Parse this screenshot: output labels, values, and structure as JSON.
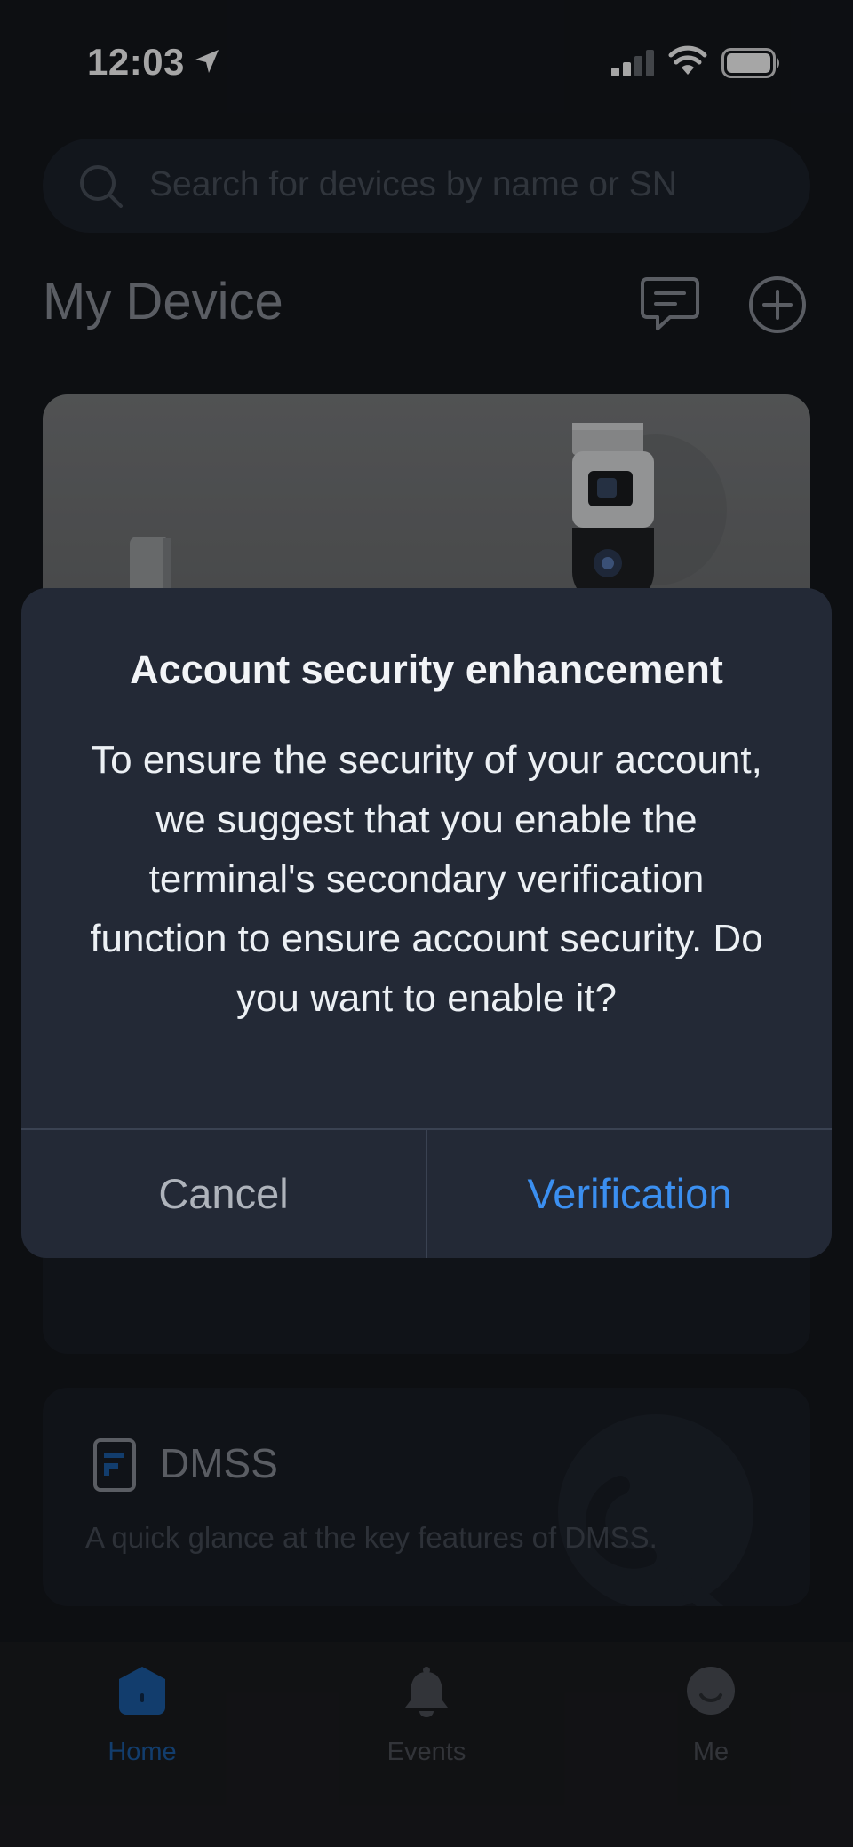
{
  "status_bar": {
    "time": "12:03"
  },
  "search": {
    "placeholder": "Search for devices by name or SN"
  },
  "header": {
    "title": "My Device"
  },
  "dmss_card": {
    "title": "DMSS",
    "description": "A quick glance at the key features of DMSS."
  },
  "dialog": {
    "title": "Account security enhancement",
    "body": "To ensure the security of your account, we suggest that you enable the terminal's secondary verification function to ensure account security. Do you want to enable it?",
    "cancel_label": "Cancel",
    "confirm_label": "Verification"
  },
  "tabs": [
    {
      "label": "Home",
      "icon": "home-icon",
      "active": true
    },
    {
      "label": "Events",
      "icon": "bell-icon",
      "active": false
    },
    {
      "label": "Me",
      "icon": "profile-icon",
      "active": false
    }
  ],
  "colors": {
    "accent": "#3b8ff0",
    "tab_active": "#1c5fa8",
    "background": "#14171d",
    "dialog_bg": "#232936"
  }
}
